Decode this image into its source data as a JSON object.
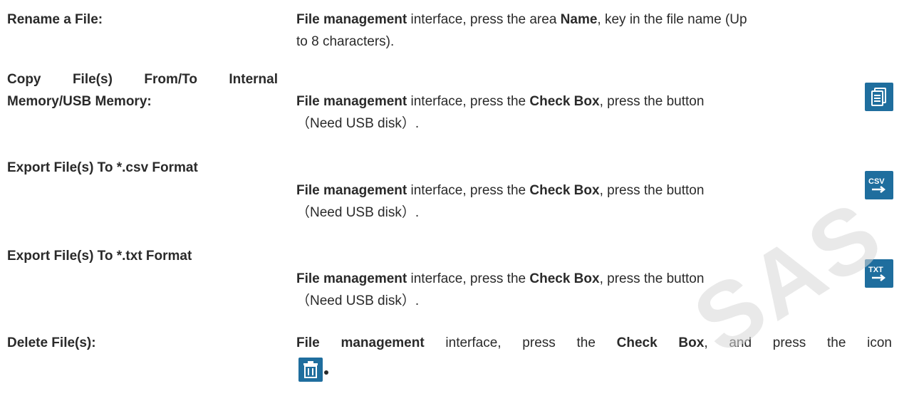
{
  "watermark": "SAS",
  "common": {
    "file_mgmt": "File management",
    "interface_press": " interface, press the ",
    "check_box": "Check Box",
    "press_button": ", press the button",
    "need_usb": "（Need USB disk）."
  },
  "rows": [
    {
      "label": "Rename a File:",
      "desc_pre": " interface, press the area ",
      "desc_bold": "Name",
      "desc_post": ", key in the file name (Up",
      "desc_line2": "to 8 characters)."
    },
    {
      "label_line1": "Copy File(s) From/To Internal",
      "label_line2": "Memory/USB Memory:",
      "icon": "copy-icon"
    },
    {
      "label": "Export File(s) To   *.csv Format",
      "icon": "csv-export-icon",
      "icon_text": "CSV"
    },
    {
      "label": "Export File(s) To   *.txt Format",
      "icon": "txt-export-icon",
      "icon_text": "TXT"
    },
    {
      "label": "Delete File(s):",
      "desc_post": ", and press the icon",
      "icon": "delete-icon"
    }
  ]
}
